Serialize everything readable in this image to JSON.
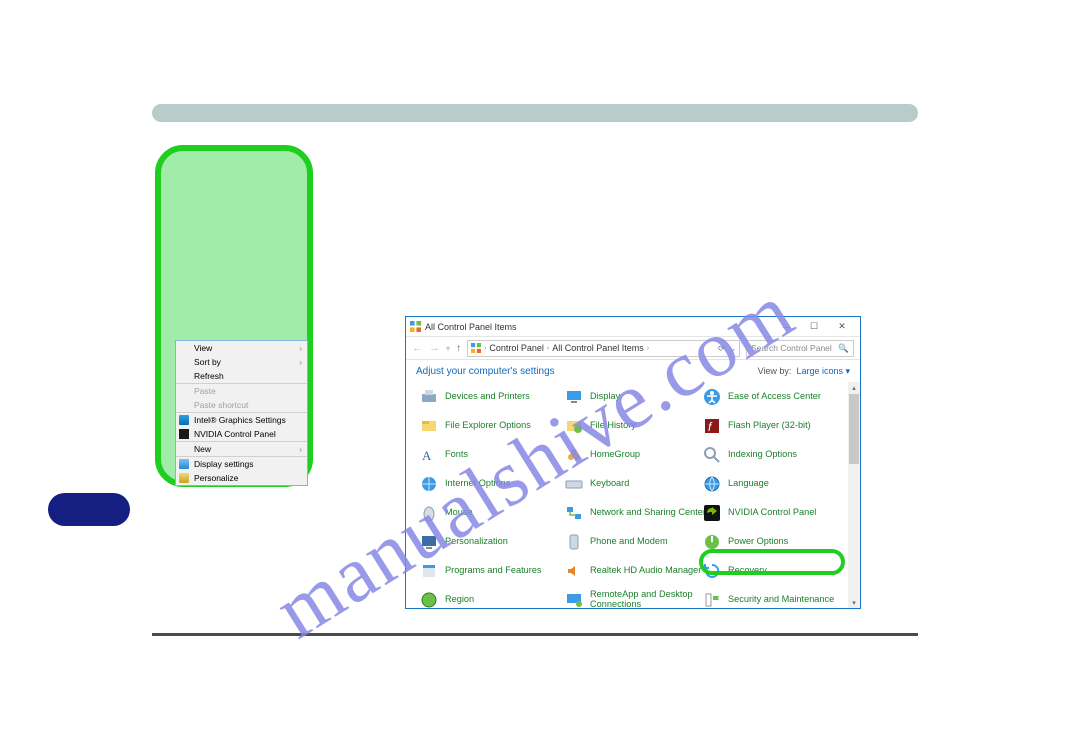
{
  "watermark": "manualshive.com",
  "contextMenu": {
    "view": "View",
    "sortBy": "Sort by",
    "refresh": "Refresh",
    "paste": "Paste",
    "pasteShortcut": "Paste shortcut",
    "intel": "Intel® Graphics Settings",
    "nvidia": "NVIDIA Control Panel",
    "new": "New",
    "displaySettings": "Display settings",
    "personalize": "Personalize"
  },
  "window": {
    "title": "All Control Panel Items",
    "nav": {
      "crumb1": "Control Panel",
      "crumb2": "All Control Panel Items",
      "searchPlaceholder": "Search Control Panel"
    },
    "subhead": "Adjust your computer's settings",
    "viewByLabel": "View by:",
    "viewByValue": "Large icons",
    "columns": {
      "c1": [
        "Devices and Printers",
        "File Explorer Options",
        "Fonts",
        "Internet Options",
        "Mouse",
        "Personalization",
        "Programs and Features",
        "Region"
      ],
      "c2": [
        "Display",
        "File History",
        "HomeGroup",
        "Keyboard",
        "Network and Sharing Center",
        "Phone and Modem",
        "Realtek HD Audio Manager",
        "RemoteApp and Desktop Connections"
      ],
      "c3": [
        "Ease of Access Center",
        "Flash Player (32-bit)",
        "Indexing Options",
        "Language",
        "NVIDIA Control Panel",
        "Power Options",
        "Recovery",
        "Security and Maintenance"
      ]
    }
  }
}
